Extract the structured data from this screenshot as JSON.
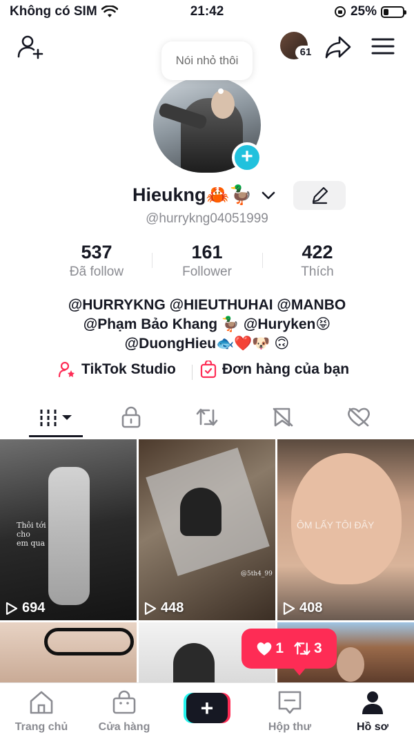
{
  "status_bar": {
    "carrier": "Không có SIM",
    "time": "21:42",
    "battery": "25%",
    "battery_level": 0.25
  },
  "header": {
    "notification_count": "61",
    "icons": [
      "add-user-icon",
      "share-icon",
      "menu-icon"
    ]
  },
  "profile": {
    "bubble_text": "Nói nhỏ thôi",
    "name": "Hieukng🦀🦆",
    "handle": "@hurrykng04051999",
    "stats": [
      {
        "value": "537",
        "label": "Đã follow"
      },
      {
        "value": "161",
        "label": "Follower"
      },
      {
        "value": "422",
        "label": "Thích"
      }
    ],
    "bio": [
      "@HURRYKNG @HIEUTHUHAI @MANBO",
      "@Phạm Bảo Khang 🦆 @Huryken😝",
      "@DuongHieu🐟❤️🐶 🙃"
    ],
    "links": [
      {
        "label": "TikTok Studio",
        "icon": "studio-icon"
      },
      {
        "label": "Đơn hàng của bạn",
        "icon": "orders-icon"
      }
    ]
  },
  "tabs": [
    {
      "icon": "videos-grid-icon",
      "active": true
    },
    {
      "icon": "lock-icon"
    },
    {
      "icon": "repost-icon"
    },
    {
      "icon": "favorites-hidden-icon"
    },
    {
      "icon": "liked-hidden-icon"
    }
  ],
  "videos": [
    {
      "views": "694",
      "caption": "Thôi tới\ncho\nem qua"
    },
    {
      "views": "448",
      "caption": "@5th4_99"
    },
    {
      "views": "408",
      "caption": "ÔM LẤY TÔI ĐÂY"
    },
    {
      "views": ""
    },
    {
      "views": ""
    },
    {
      "views": ""
    }
  ],
  "notification": {
    "likes": "1",
    "reposts": "3"
  },
  "bottom_nav": [
    {
      "label": "Trang chủ",
      "icon": "home-icon"
    },
    {
      "label": "Cửa hàng",
      "icon": "shop-icon"
    },
    {
      "label": "",
      "icon": "create-icon"
    },
    {
      "label": "Hộp thư",
      "icon": "inbox-icon"
    },
    {
      "label": "Hồ sơ",
      "icon": "profile-icon",
      "active": true
    }
  ]
}
